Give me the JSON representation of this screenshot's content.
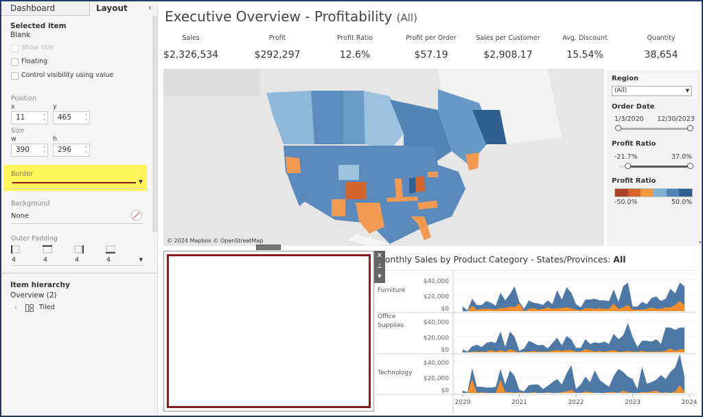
{
  "left_panel": {
    "tabs": [
      {
        "label": "Dashboard"
      },
      {
        "label": "Layout"
      }
    ],
    "collapse_icon": "chevron-left-icon",
    "selected_item_heading": "Selected item",
    "selected_item_value": "Blank",
    "checkboxes": [
      {
        "label": "Show title",
        "checked": false,
        "disabled": true
      },
      {
        "label": "Floating",
        "checked": false
      },
      {
        "label": "Control visibility using value",
        "checked": false
      }
    ],
    "position_label": "Position",
    "x_label": "x",
    "x_value": "11",
    "y_label": "y",
    "y_value": "465",
    "size_label": "Size",
    "w_label": "w",
    "w_value": "390",
    "h_label": "h",
    "h_value": "296",
    "border_label": "Border",
    "border_color": "#8b1a1a",
    "highlight_color": "#fff35c",
    "background_label": "Background",
    "background_value": "None",
    "outer_padding_label": "Outer Padding",
    "padding": [
      "4",
      "4",
      "4",
      "4"
    ],
    "item_hierarchy_heading": "Item hierarchy",
    "hierarchy_root": "Overview (2)",
    "hierarchy_child": "Tiled"
  },
  "header": {
    "title": "Executive Overview - Profitability",
    "title_suffix": "(All)"
  },
  "kpis": [
    {
      "label": "Sales",
      "value": "$2,326,534"
    },
    {
      "label": "Profit",
      "value": "$292,297"
    },
    {
      "label": "Profit Ratio",
      "value": "12.6%"
    },
    {
      "label": "Profit per Order",
      "value": "$57.19"
    },
    {
      "label": "Sales per Customer",
      "value": "$2,908.17"
    },
    {
      "label": "Avg. Discount",
      "value": "15.54%"
    },
    {
      "label": "Quantity",
      "value": "38,654"
    }
  ],
  "map": {
    "attribution": "© 2024 Mapbox © OpenStreetMap"
  },
  "filters": {
    "region_label": "Region",
    "region_value": "(All)",
    "order_date_label": "Order Date",
    "date_start": "1/3/2020",
    "date_end": "12/30/2023",
    "profit_ratio_label": "Profit Ratio",
    "pr_min": "-21.7%",
    "pr_max": "37.0%",
    "legend_label": "Profit Ratio",
    "legend_min": "-50.0%",
    "legend_max": "50.0%",
    "legend_colors": [
      "#a9432a",
      "#d9652b",
      "#f5993f",
      "#7fb0d6",
      "#4f86b8",
      "#2f5f8f"
    ]
  },
  "chart_title_prefix": "Monthly Sales by Product Category - States/Provinces: ",
  "chart_title_bold": "All",
  "chart_data": {
    "type": "area",
    "title": "Monthly Sales by Product Category - States/Provinces: All",
    "x_ticks": [
      "2020",
      "2021",
      "2022",
      "2023",
      "2024"
    ],
    "y_ticks": [
      "$40,000",
      "$20,000",
      "$0"
    ],
    "ylim": [
      0,
      45000
    ],
    "x_start": "2020-01",
    "x_end": "2023-12",
    "colors": {
      "sales": "#4e79a7",
      "profit": "#f28e2b"
    },
    "panels": [
      {
        "category": "Furniture",
        "sales": [
          6,
          1,
          16,
          8,
          8,
          13,
          11,
          7,
          24,
          14,
          22,
          32,
          12,
          3,
          14,
          11,
          10,
          8,
          14,
          9,
          27,
          15,
          31,
          24,
          9,
          5,
          15,
          15,
          16,
          14,
          14,
          13,
          28,
          12,
          32,
          37,
          6,
          6,
          12,
          9,
          17,
          19,
          13,
          16,
          29,
          23,
          37,
          32
        ],
        "profit": [
          0,
          0,
          7,
          2,
          3,
          3,
          3,
          2,
          4,
          4,
          6,
          5,
          10,
          0,
          3,
          4,
          2,
          3,
          5,
          3,
          4,
          4,
          5,
          4,
          2,
          1,
          4,
          4,
          3,
          4,
          3,
          3,
          10,
          3,
          5,
          8,
          2,
          2,
          2,
          3,
          5,
          3,
          3,
          5,
          5,
          8,
          13,
          8
        ]
      },
      {
        "category": "Office Supplies",
        "sales": [
          4,
          1,
          8,
          10,
          7,
          12,
          14,
          12,
          27,
          7,
          27,
          20,
          2,
          5,
          15,
          12,
          9,
          10,
          5,
          12,
          19,
          9,
          21,
          17,
          6,
          6,
          17,
          11,
          13,
          12,
          14,
          11,
          24,
          17,
          22,
          38,
          20,
          7,
          15,
          15,
          14,
          17,
          11,
          32,
          32,
          29,
          32,
          32
        ],
        "profit": [
          0,
          0,
          1,
          1,
          1,
          1,
          3,
          1,
          3,
          1,
          4,
          2,
          0,
          1,
          1,
          2,
          1,
          1,
          1,
          2,
          3,
          2,
          3,
          3,
          1,
          1,
          4,
          3,
          1,
          2,
          1,
          2,
          3,
          1,
          1,
          2,
          1,
          1,
          2,
          1,
          1,
          1,
          1,
          2,
          5,
          2,
          4,
          4
        ]
      },
      {
        "category": "Technology",
        "sales": [
          3,
          1,
          32,
          8,
          8,
          7,
          7,
          8,
          31,
          11,
          29,
          22,
          4,
          2,
          10,
          11,
          11,
          5,
          9,
          14,
          18,
          11,
          25,
          36,
          5,
          11,
          21,
          14,
          29,
          17,
          12,
          8,
          22,
          31,
          27,
          21,
          18,
          5,
          34,
          12,
          14,
          17,
          23,
          18,
          27,
          33,
          50,
          21
        ],
        "profit": [
          0,
          0,
          18,
          0,
          1,
          0,
          0,
          0,
          17,
          1,
          1,
          0,
          1,
          0,
          0,
          1,
          0,
          0,
          1,
          0,
          0,
          1,
          2,
          4,
          0,
          0,
          2,
          1,
          0,
          0,
          0,
          1,
          1,
          0,
          3,
          1,
          0,
          0,
          1,
          1,
          2,
          3,
          0,
          1,
          0,
          2,
          10,
          1
        ]
      }
    ],
    "value_unit": "thousands USD"
  }
}
